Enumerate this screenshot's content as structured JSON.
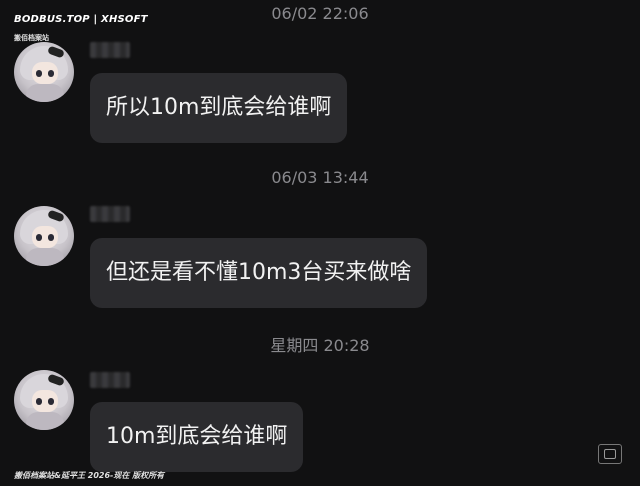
{
  "watermark": {
    "top": "BODBUS.TOP | XHSOFT",
    "sub": "搬佰档案站",
    "bottom": "搬佰档案站&延平王 2026-现在 版权所有"
  },
  "messages": [
    {
      "timestamp": "06/02 22:06",
      "text": "所以10m到底会给谁啊"
    },
    {
      "timestamp": "06/03 13:44",
      "text": "但还是看不懂10m3台买来做啥"
    },
    {
      "timestamp": "星期四 20:28",
      "text": "10m到底会给谁啊"
    }
  ]
}
